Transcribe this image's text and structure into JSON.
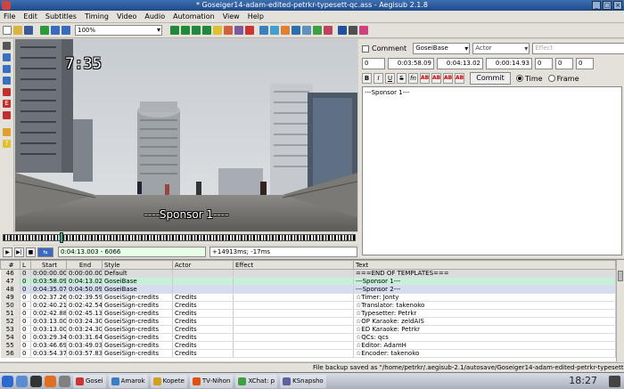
{
  "window": {
    "title": "* Goseiger14-adam-edited-petrkr-typesett-qc.ass - Aegisub 2.1.8"
  },
  "menu": [
    "File",
    "Edit",
    "Subtitles",
    "Timing",
    "Video",
    "Audio",
    "Automation",
    "View",
    "Help"
  ],
  "toolbar": {
    "zoom_value": "100%"
  },
  "video": {
    "timestamp": "7:35",
    "subtitle": "----Sponsor 1----"
  },
  "video_controls": {
    "time_field": "0:04:13.003 - 6066",
    "offset_field": "+14913ms; -17ms"
  },
  "edit": {
    "comment_label": "Comment",
    "style": "GoseiBase",
    "actor_placeholder": "Actor",
    "effect_placeholder": "Effect",
    "layer": "0",
    "start": "0:03:58.09",
    "end": "0:04:13.02",
    "duration": "0:00:14.93",
    "margin_l": "0",
    "margin_r": "0",
    "margin_v": "0",
    "format_buttons": [
      "B",
      "I",
      "U",
      "S",
      "fn",
      "AB",
      "AB",
      "AB",
      "AB"
    ],
    "commit_label": "Commit",
    "time_label": "Time",
    "frame_label": "Frame",
    "text": "---Sponsor 1---"
  },
  "grid": {
    "headers": [
      "#",
      "L",
      "Start",
      "End",
      "Style",
      "Actor",
      "Effect",
      "Text"
    ],
    "rows": [
      {
        "n": "46",
        "l": "0",
        "start": "0:00:00.00",
        "end": "0:00:00.00",
        "style": "Default",
        "actor": "",
        "effect": "",
        "text": "===END OF TEMPLATES===",
        "bg": "#dcdcdc"
      },
      {
        "n": "47",
        "l": "0",
        "start": "0:03:58.09",
        "end": "0:04:13.02",
        "style": "GoseiBase",
        "actor": "",
        "effect": "",
        "text": "---Sponsor 1---",
        "bg": "#c6f0d8"
      },
      {
        "n": "48",
        "l": "0",
        "start": "0:04:35.07",
        "end": "0:04:50.09",
        "style": "GoseiBase",
        "actor": "",
        "effect": "",
        "text": "---Sponsor 2---",
        "bg": "#d6dcf2"
      },
      {
        "n": "49",
        "l": "0",
        "start": "0:02:37.26",
        "end": "0:02:39.59",
        "style": "GoseiSign-credits",
        "actor": "Credits",
        "effect": "",
        "text": "☆Timer: Jonty",
        "bg": "#ffffff"
      },
      {
        "n": "50",
        "l": "0",
        "start": "0:02:40.21",
        "end": "0:02:42.54",
        "style": "GoseiSign-credits",
        "actor": "Credits",
        "effect": "",
        "text": "☆Translator: takenoko",
        "bg": "#ffffff"
      },
      {
        "n": "51",
        "l": "0",
        "start": "0:02:42.88",
        "end": "0:02:45.13",
        "style": "GoseiSign-credits",
        "actor": "Credits",
        "effect": "",
        "text": "☆Typesetter: Petrkr",
        "bg": "#ffffff"
      },
      {
        "n": "52",
        "l": "0",
        "start": "0:03:13.00",
        "end": "0:03:24.30",
        "style": "GoseiSign-credits",
        "actor": "Credits",
        "effect": "",
        "text": "☆OP Karaoke: zeldAIS",
        "bg": "#ffffff"
      },
      {
        "n": "53",
        "l": "0",
        "start": "0:03:13.00",
        "end": "0:03:24.30",
        "style": "GoseiSign-credits",
        "actor": "Credits",
        "effect": "",
        "text": "☆ED Karaoke: Petrkr",
        "bg": "#ffffff"
      },
      {
        "n": "54",
        "l": "0",
        "start": "0:03:29.34",
        "end": "0:03:31.64",
        "style": "GoseiSign-credits",
        "actor": "Credits",
        "effect": "",
        "text": "☆QCs: qcs",
        "bg": "#ffffff"
      },
      {
        "n": "55",
        "l": "0",
        "start": "0:03:46.69",
        "end": "0:03:49.03",
        "style": "GoseiSign-credits",
        "actor": "Credits",
        "effect": "",
        "text": "☆Editor: AdamH",
        "bg": "#ffffff"
      },
      {
        "n": "56",
        "l": "0",
        "start": "0:03:54.37",
        "end": "0:03:57.83",
        "style": "GoseiSign-credits",
        "actor": "Credits",
        "effect": "",
        "text": "☆Encoder: takenoko",
        "bg": "#ffffff"
      }
    ]
  },
  "status": {
    "text": "File backup saved as \"/home/petrkr/.aegisub-2.1/autosave/Goseiger14-adam-edited-petrkr-typesett"
  },
  "taskbar": {
    "items": [
      "Gosei",
      "Amarok",
      "Kopete",
      "TV-Nihon",
      "XChat: p",
      "KSnapsho"
    ],
    "clock": "18:27"
  }
}
